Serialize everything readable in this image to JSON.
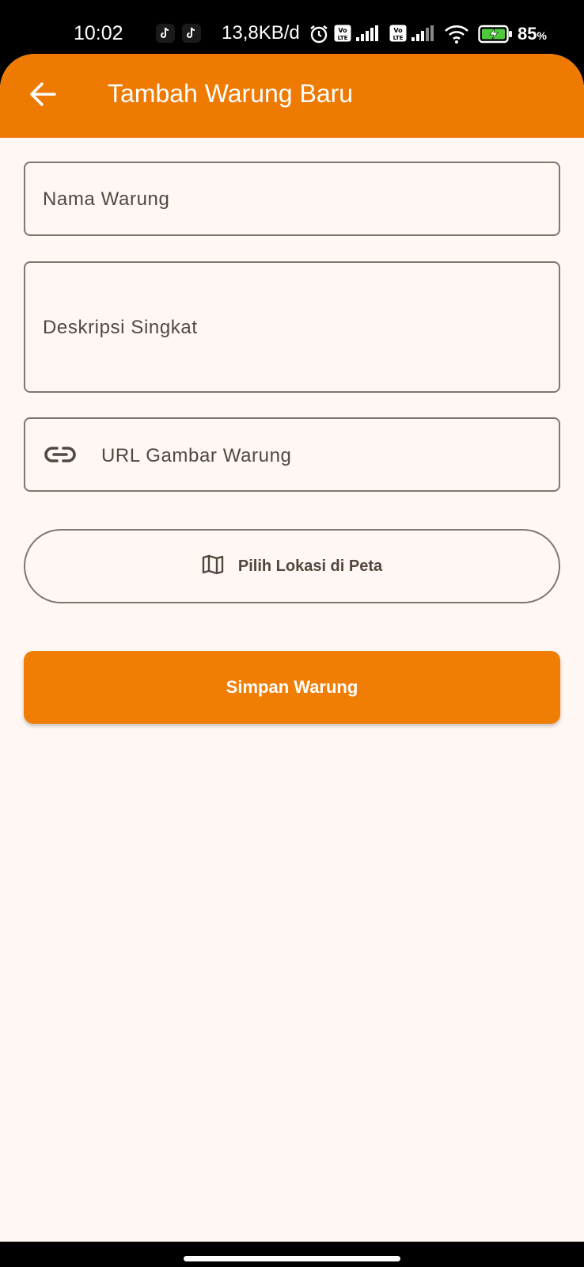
{
  "status_bar": {
    "time": "10:02",
    "network_speed": "13,8KB/d",
    "battery_percent": "85",
    "battery_unit": "%",
    "icons": [
      "tiktok-icon",
      "tiktok-icon",
      "alarm-icon",
      "volte-icon",
      "signal-icon",
      "volte-icon",
      "signal-icon",
      "wifi-icon",
      "battery-charging-icon"
    ]
  },
  "app_bar": {
    "title": "Tambah Warung Baru",
    "back_icon": "arrow-back-icon",
    "color": "#ee7a02"
  },
  "form": {
    "name_placeholder": "Nama Warung",
    "description_placeholder": "Deskripsi Singkat",
    "image_url_placeholder": "URL Gambar Warung",
    "image_url_icon": "link-icon"
  },
  "map_button": {
    "label": "Pilih Lokasi di Peta",
    "icon": "map-icon"
  },
  "save_button": {
    "label": "Simpan Warung",
    "color": "#f07d04"
  }
}
